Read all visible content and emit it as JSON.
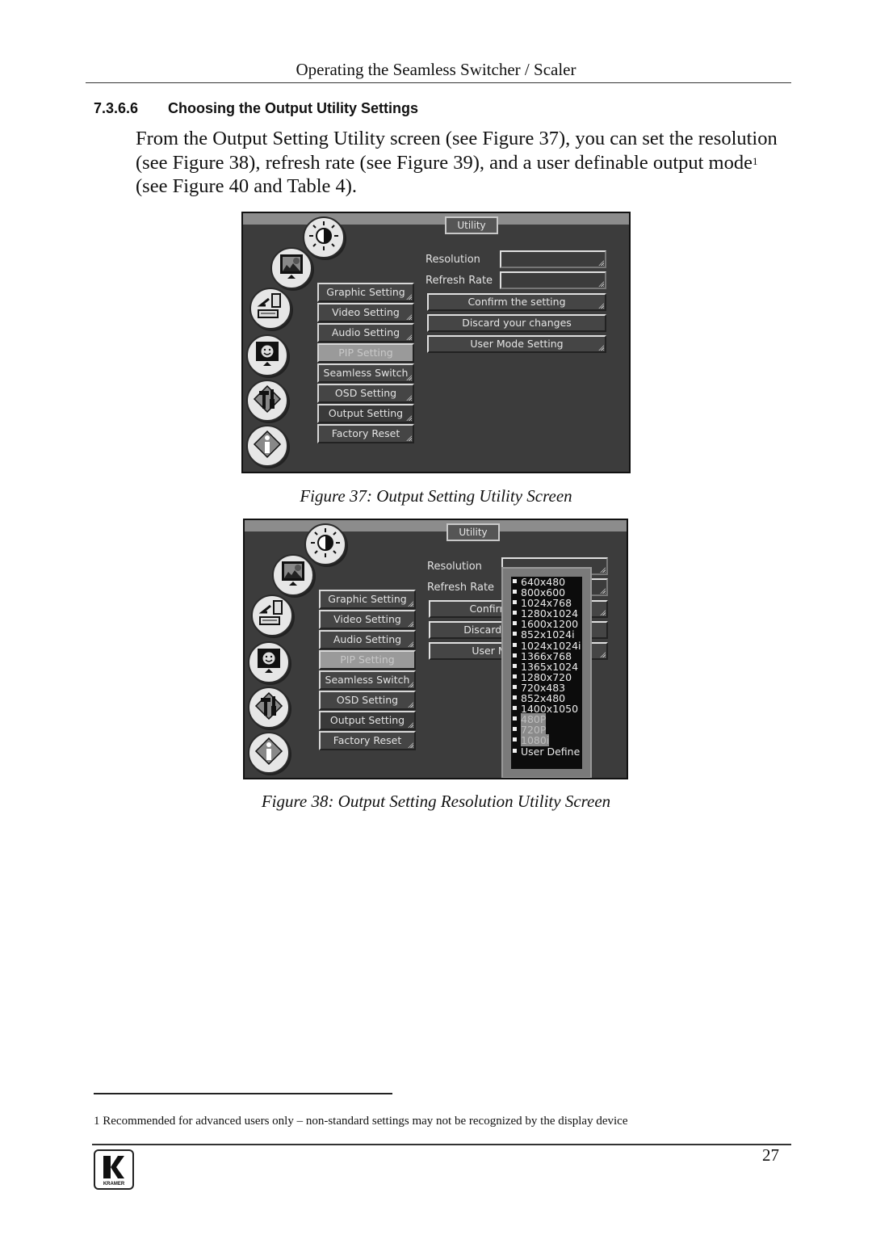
{
  "page": {
    "running_head": "Operating the Seamless Switcher / Scaler",
    "section_number": "7.3.6.6",
    "section_title": "Choosing the Output Utility Settings",
    "paragraph": {
      "part1": "From the Output Setting Utility screen (see Figure 37), you can set the resolution (see Figure 38), refresh rate (see Figure 39), and a user definable output mode",
      "footnote_ref": "1",
      "part2": " (see Figure 40 and Table 4)."
    },
    "footnote": "1 Recommended for advanced users only – non-standard settings may not be recognized by the display device",
    "page_number": "27",
    "logo_text": "KRAMER"
  },
  "figures": [
    {
      "caption": "Figure 37: Output Setting Utility Screen",
      "screen": {
        "title": "Utility",
        "side_icons": [
          "brightness-icon",
          "picture-icon",
          "input-icon",
          "geometry-icon",
          "tools-icon",
          "info-icon"
        ],
        "menu": [
          {
            "label": "Graphic Setting",
            "state": "normal"
          },
          {
            "label": "Video Setting",
            "state": "normal"
          },
          {
            "label": "Audio Setting",
            "state": "normal"
          },
          {
            "label": "PIP Setting",
            "state": "disabled"
          },
          {
            "label": "Seamless Switch",
            "state": "normal"
          },
          {
            "label": "OSD Setting",
            "state": "normal"
          },
          {
            "label": "Output Setting",
            "state": "selected"
          },
          {
            "label": "Factory Reset",
            "state": "normal"
          }
        ],
        "resolution_label": "Resolution",
        "resolution_value": "",
        "refresh_label": "Refresh Rate",
        "refresh_value": "",
        "buttons": [
          "Confirm the setting",
          "Discard your changes",
          "User Mode Setting"
        ]
      }
    },
    {
      "caption": "Figure 38: Output Setting Resolution Utility Screen",
      "screen": {
        "title": "Utility",
        "menu": [
          {
            "label": "Graphic Setting",
            "state": "normal"
          },
          {
            "label": "Video Setting",
            "state": "normal"
          },
          {
            "label": "Audio Setting",
            "state": "normal"
          },
          {
            "label": "PIP Setting",
            "state": "disabled"
          },
          {
            "label": "Seamless Switch",
            "state": "normal"
          },
          {
            "label": "OSD Setting",
            "state": "normal"
          },
          {
            "label": "Output Setting",
            "state": "selected"
          },
          {
            "label": "Factory Reset",
            "state": "normal"
          }
        ],
        "resolution_label": "Resolution",
        "refresh_label": "Refresh Rate",
        "buttons": [
          "Confirm the setting",
          "Discard your changes",
          "User Mode Setting"
        ],
        "resolution_options": [
          {
            "label": "640x480",
            "state": "normal"
          },
          {
            "label": "800x600",
            "state": "normal"
          },
          {
            "label": "1024x768",
            "state": "normal"
          },
          {
            "label": "1280x1024",
            "state": "normal"
          },
          {
            "label": "1600x1200",
            "state": "normal"
          },
          {
            "label": "852x1024i",
            "state": "normal"
          },
          {
            "label": "1024x1024i",
            "state": "normal"
          },
          {
            "label": "1366x768",
            "state": "normal"
          },
          {
            "label": "1365x1024",
            "state": "normal"
          },
          {
            "label": "1280x720",
            "state": "normal"
          },
          {
            "label": "720x483",
            "state": "normal"
          },
          {
            "label": "852x480",
            "state": "normal"
          },
          {
            "label": "1400x1050",
            "state": "normal"
          },
          {
            "label": "480P",
            "state": "disabled"
          },
          {
            "label": "720P",
            "state": "disabled"
          },
          {
            "label": "1080i",
            "state": "disabled"
          },
          {
            "label": "User Define",
            "state": "normal"
          }
        ]
      }
    }
  ]
}
